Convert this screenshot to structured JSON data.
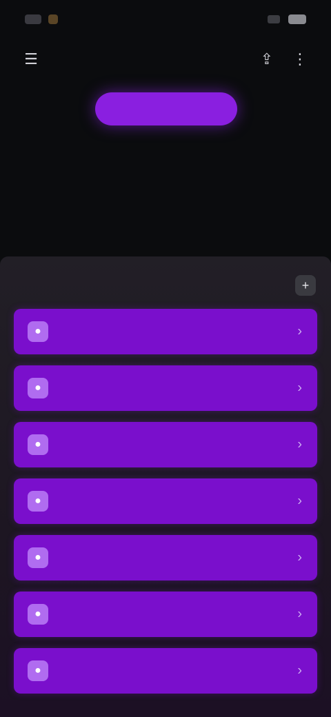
{
  "status_bar": {
    "time": "",
    "battery": ""
  },
  "top_bar": {
    "menu_icon": "menu-icon",
    "title": "",
    "left_action_icon": "share-icon",
    "right_action_icon": "more-icon"
  },
  "primary_button": {
    "label": ""
  },
  "headline": "",
  "panel": {
    "label": "",
    "action_icon": "add-icon",
    "items": [
      {
        "label": ""
      },
      {
        "label": ""
      },
      {
        "label": ""
      },
      {
        "label": ""
      },
      {
        "label": ""
      },
      {
        "label": ""
      },
      {
        "label": ""
      }
    ]
  },
  "colors": {
    "background": "#0b0c0e",
    "accent": "#8a1fe0",
    "item": "#7a0fcc",
    "panel": "#221f26"
  }
}
